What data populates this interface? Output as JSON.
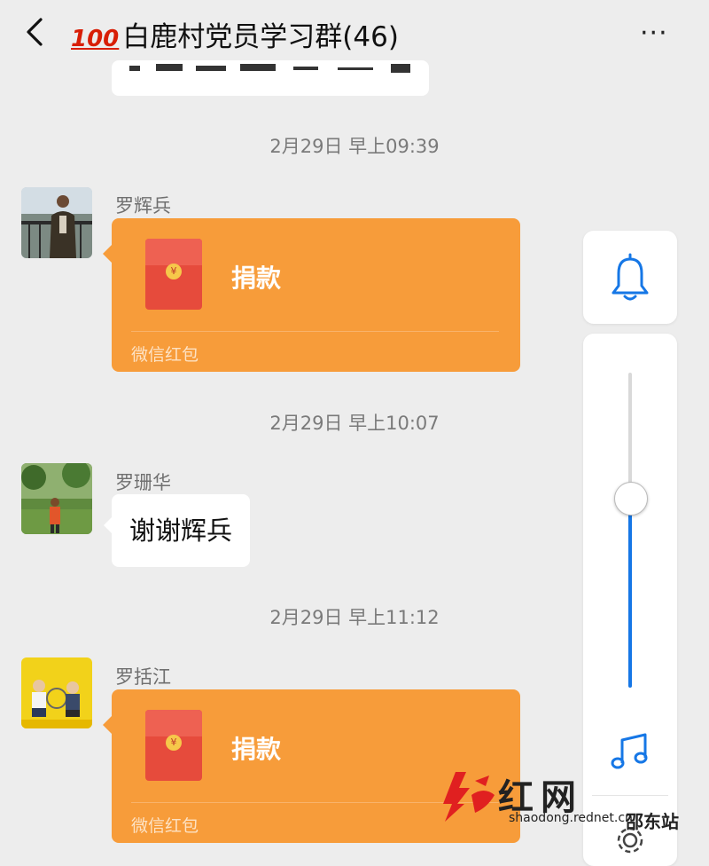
{
  "header": {
    "back_icon": "chevron-left-icon",
    "title_emoji": "100",
    "title": "白鹿村党员学习群(46)",
    "more_icon": "more-dots-icon",
    "more_glyph": "···"
  },
  "messages": [
    {
      "type": "time",
      "text": "2月29日 早上09:39"
    },
    {
      "type": "red_packet",
      "sender": "罗辉兵",
      "title": "捐款",
      "footer": "微信红包"
    },
    {
      "type": "time",
      "text": "2月29日 早上10:07"
    },
    {
      "type": "text",
      "sender": "罗珊华",
      "text": "谢谢辉兵"
    },
    {
      "type": "time",
      "text": "2月29日 早上11:12"
    },
    {
      "type": "red_packet",
      "sender": "罗括江",
      "title": "捐款",
      "footer": "微信红包"
    }
  ],
  "volume_overlay": {
    "bell_icon": "bell-icon",
    "music_icon": "music-note-icon",
    "settings_icon": "gear-icon",
    "level": 0.59,
    "accent": "#1677e6"
  },
  "watermark": {
    "brand": "红网",
    "url": "shaodong.rednet.cn",
    "station": "邵东站"
  },
  "colors": {
    "background": "#ededed",
    "red_packet": "#f79c3a"
  }
}
